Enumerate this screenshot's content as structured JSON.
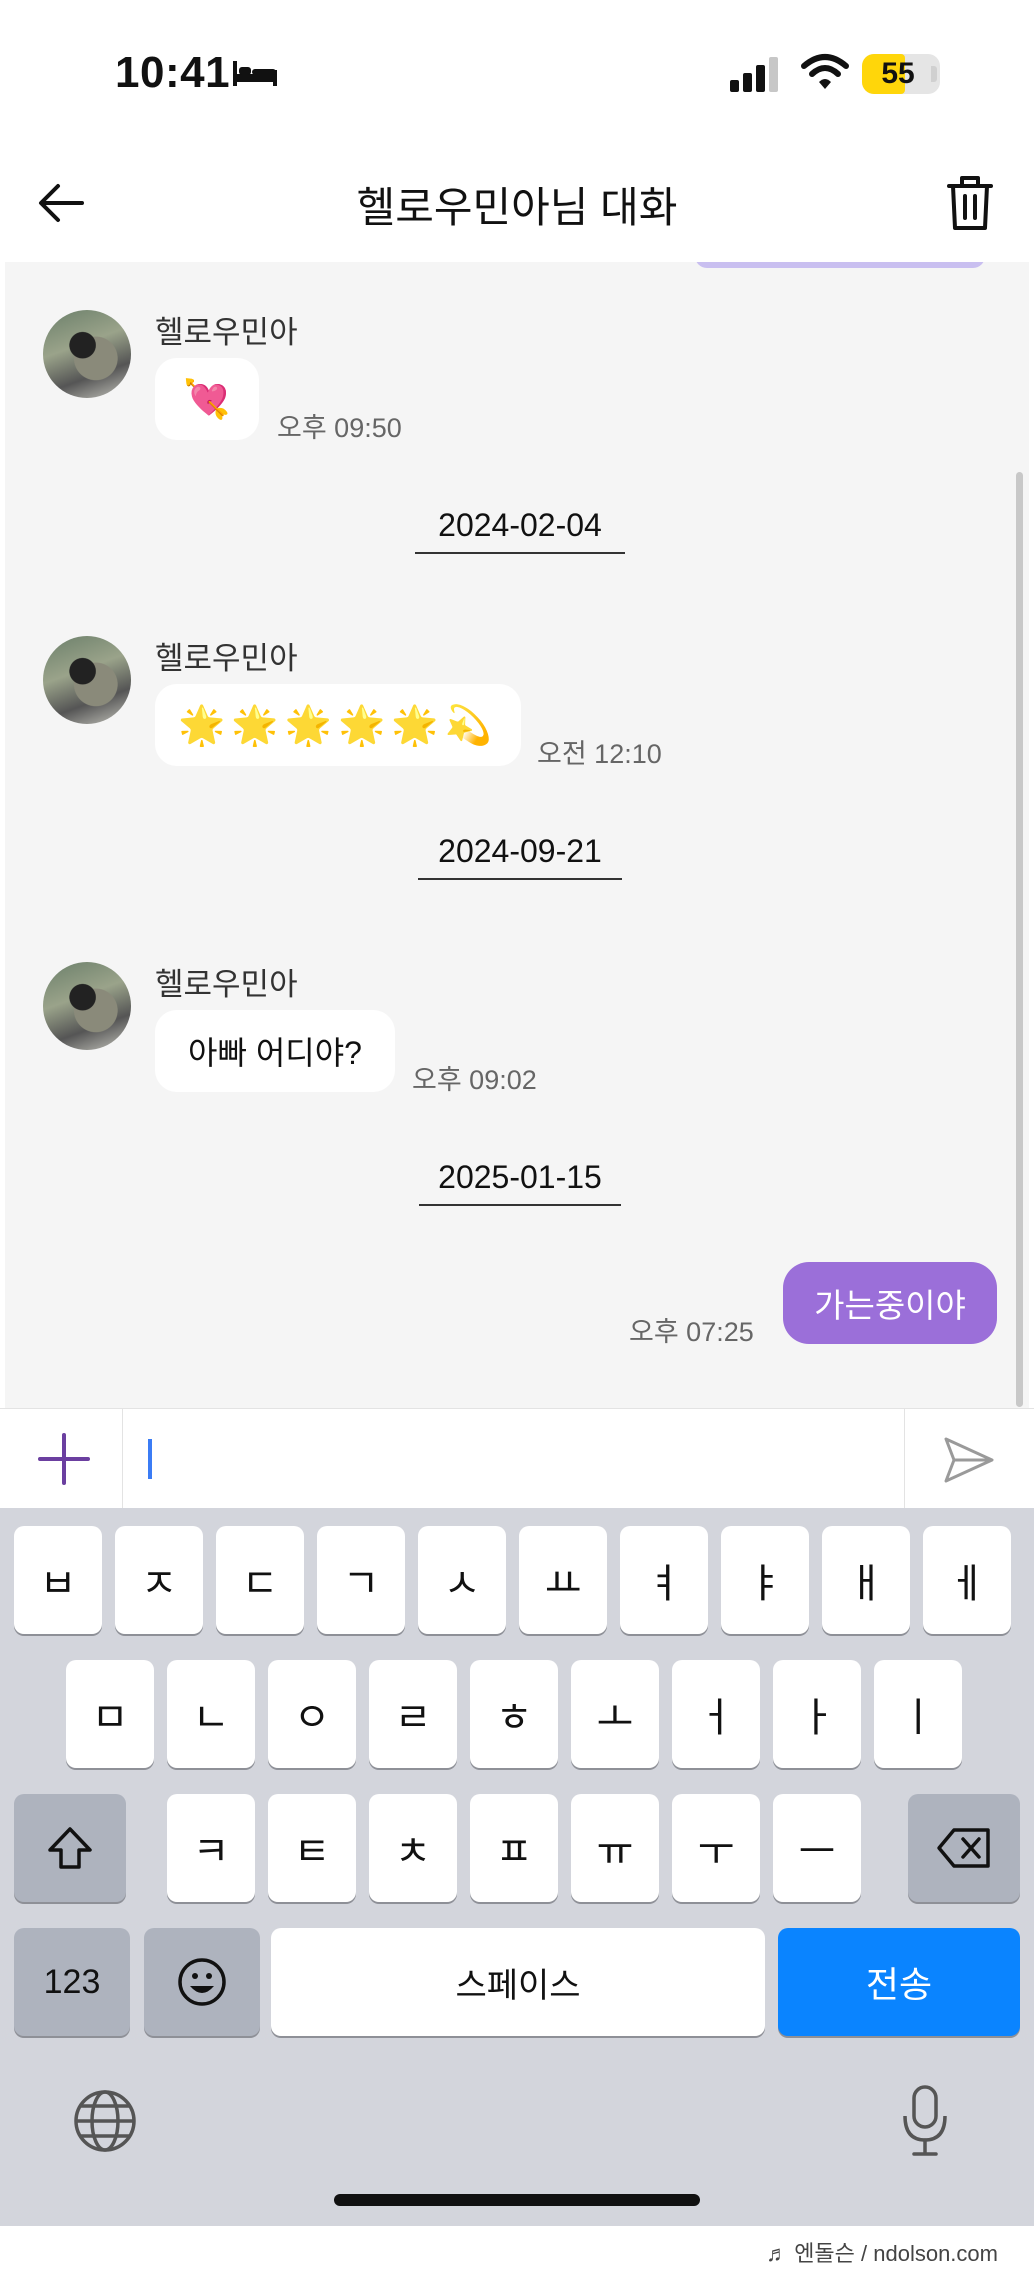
{
  "status_bar": {
    "time": "10:41",
    "battery": "55",
    "battery_level": 0.55
  },
  "header": {
    "title": "헬로우민아님 대화"
  },
  "messages": [
    {
      "sender": "헬로우민아",
      "text": "💘",
      "time": "오후 09:50"
    },
    {
      "date": "2024-02-04"
    },
    {
      "sender": "헬로우민아",
      "text": "🌟🌟🌟🌟🌟💫",
      "time": "오전 12:10"
    },
    {
      "date": "2024-09-21"
    },
    {
      "sender": "헬로우민아",
      "text": "아빠 어디야?",
      "time": "오후 09:02"
    },
    {
      "date": "2025-01-15"
    },
    {
      "mine": true,
      "text": "가는중이야",
      "time": "오후 07:25"
    }
  ],
  "input": {
    "value": ""
  },
  "keyboard": {
    "row1": [
      "ㅂ",
      "ㅈ",
      "ㄷ",
      "ㄱ",
      "ㅅ",
      "ㅛ",
      "ㅕ",
      "ㅑ",
      "ㅐ",
      "ㅔ"
    ],
    "row2": [
      "ㅁ",
      "ㄴ",
      "ㅇ",
      "ㄹ",
      "ㅎ",
      "ㅗ",
      "ㅓ",
      "ㅏ",
      "ㅣ"
    ],
    "row3": [
      "ㅋ",
      "ㅌ",
      "ㅊ",
      "ㅍ",
      "ㅠ",
      "ㅜ",
      "ㅡ"
    ],
    "num_label": "123",
    "space_label": "스페이스",
    "send_label": "전송"
  },
  "footer": {
    "watermark": "♬ 엔돌슨 / ndolson.com"
  },
  "colors": {
    "my_bubble": "#9b6fd9",
    "send_key": "#0a84ff",
    "battery": "#ffd60a",
    "accent_plus": "#6b3fa0"
  }
}
